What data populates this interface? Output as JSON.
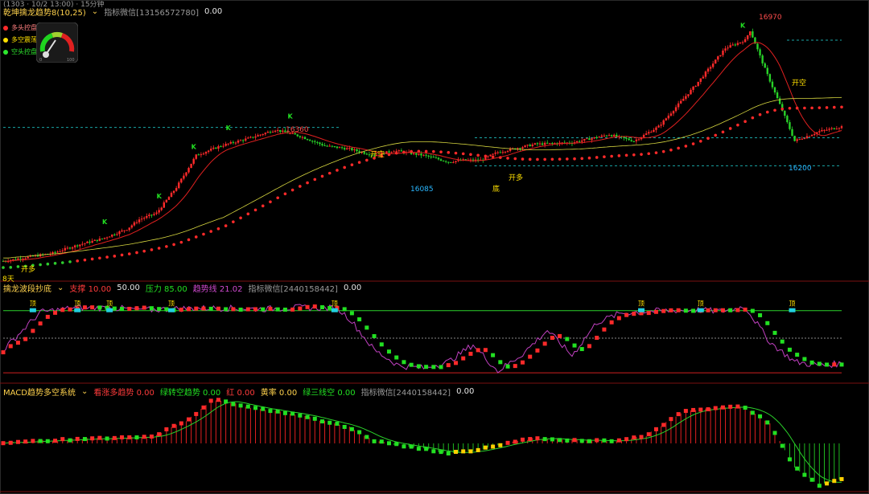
{
  "top_strip": "(1303 · 10/2 13:00) · 15分钟",
  "main": {
    "title": "乾坤擒龙趋势8(10,25)",
    "chevron": "⌄",
    "indicator_name": "指标微信[13156572780]",
    "indicator_value": "0.00",
    "legend": [
      {
        "label": "多头控盘",
        "color": "#ff2b2b"
      },
      {
        "label": "多空震荡",
        "color": "#ffe000"
      },
      {
        "label": "空头控盘",
        "color": "#2ee62e"
      }
    ],
    "gauge_labels": {
      "low": "0",
      "high": "100"
    },
    "annotations": [
      {
        "text": "16970",
        "color": "#ff4d4d"
      },
      {
        "text": "16360",
        "color": "#ff4d4d"
      },
      {
        "text": "16085",
        "color": "#2ab7ff"
      },
      {
        "text": "16200",
        "color": "#2ab7ff"
      },
      {
        "text": "开多",
        "color": "#ffe000"
      },
      {
        "text": "开空",
        "color": "#ffe000"
      },
      {
        "text": "开多",
        "color": "#ffe000"
      },
      {
        "text": "开空",
        "color": "#ffe000"
      },
      {
        "text": "底",
        "color": "#ffe000"
      },
      {
        "text": "8天",
        "color": "#ffe000"
      }
    ]
  },
  "sub1": {
    "title": "擒龙波段抄底",
    "items": [
      {
        "label": "支撑",
        "value": "10.00",
        "color": "#ff3b3b"
      },
      {
        "label": "",
        "value": "50.00",
        "color": "#e6e6e6"
      },
      {
        "label": "压力",
        "value": "85.00",
        "color": "#22e022"
      },
      {
        "label": "趋势线",
        "value": "21.02",
        "color": "#d04ad0"
      }
    ],
    "indicator_name": "指标微信[2440158442]",
    "indicator_value": "0.00",
    "marker_char": "顶"
  },
  "sub2": {
    "title": "MACD趋势多空系统",
    "items": [
      {
        "label": "看涨多趋势",
        "value": "0.00",
        "color": "#ff3b3b"
      },
      {
        "label": "绿转空趋势",
        "value": "0.00",
        "color": "#22e022"
      },
      {
        "label": "红",
        "value": "0.00",
        "color": "#ff3b3b"
      },
      {
        "label": "黄率",
        "value": "0.00",
        "color": "#ffd24d"
      },
      {
        "label": "绿三线空",
        "value": "0.00",
        "color": "#22e022"
      }
    ],
    "indicator_name": "指标微信[2440158442]",
    "indicator_value": "0.00"
  },
  "chart_data": [
    {
      "type": "candlestick",
      "title": "乾坤擒龙趋势8(10,25)",
      "ylim": [
        15420,
        17050
      ],
      "y_labels": {
        "high_peak": 16970,
        "mid_peak": 16360,
        "trough": 16085,
        "recent_low": 16200
      },
      "x_count": 160,
      "series": [
        {
          "name": "close",
          "keypoints": [
            [
              0,
              15520
            ],
            [
              10,
              15545
            ],
            [
              20,
              15570
            ],
            [
              30,
              15620
            ],
            [
              40,
              15660
            ],
            [
              50,
              15720
            ],
            [
              55,
              15780
            ],
            [
              62,
              15820
            ],
            [
              70,
              15980
            ],
            [
              78,
              16180
            ],
            [
              88,
              16240
            ],
            [
              100,
              16290
            ],
            [
              110,
              16340
            ],
            [
              120,
              16300
            ],
            [
              130,
              16240
            ],
            [
              140,
              16220
            ],
            [
              150,
              16180
            ],
            [
              158,
              16210
            ],
            [
              170,
              16180
            ],
            [
              180,
              16140
            ],
            [
              186,
              16150
            ],
            [
              193,
              16150
            ],
            [
              200,
              16200
            ],
            [
              215,
              16250
            ],
            [
              230,
              16260
            ],
            [
              245,
              16310
            ],
            [
              255,
              16270
            ],
            [
              265,
              16360
            ],
            [
              280,
              16620
            ],
            [
              292,
              16850
            ],
            [
              300,
              16900
            ],
            [
              302,
              16960
            ],
            [
              308,
              16720
            ],
            [
              315,
              16460
            ],
            [
              320,
              16270
            ],
            [
              330,
              16330
            ],
            [
              339,
              16360
            ]
          ]
        }
      ]
    },
    {
      "type": "line",
      "title": "擒龙波段抄底",
      "ylim": [
        0,
        100
      ],
      "hlines": [
        10,
        50,
        85
      ],
      "series": [
        {
          "name": "趋势线",
          "keypoints": [
            [
              0,
              35
            ],
            [
              15,
              83
            ],
            [
              30,
              89
            ],
            [
              45,
              88
            ],
            [
              60,
              86
            ],
            [
              75,
              88
            ],
            [
              90,
              88
            ],
            [
              105,
              87
            ],
            [
              120,
              89
            ],
            [
              135,
              88
            ],
            [
              140,
              75
            ],
            [
              150,
              35
            ],
            [
              160,
              15
            ],
            [
              170,
              12
            ],
            [
              180,
              20
            ],
            [
              190,
              42
            ],
            [
              200,
              8
            ],
            [
              210,
              30
            ],
            [
              220,
              60
            ],
            [
              230,
              28
            ],
            [
              240,
              70
            ],
            [
              250,
              82
            ],
            [
              260,
              84
            ],
            [
              270,
              85
            ],
            [
              280,
              86
            ],
            [
              290,
              84
            ],
            [
              300,
              90
            ],
            [
              310,
              45
            ],
            [
              320,
              20
            ],
            [
              330,
              15
            ],
            [
              339,
              18
            ]
          ]
        }
      ]
    },
    {
      "type": "bar",
      "title": "MACD趋势多空系统",
      "ylim": [
        -60,
        60
      ],
      "series": [
        {
          "name": "MACD",
          "keypoints": [
            [
              0,
              1
            ],
            [
              20,
              4
            ],
            [
              40,
              6
            ],
            [
              60,
              8
            ],
            [
              75,
              30
            ],
            [
              85,
              55
            ],
            [
              100,
              45
            ],
            [
              120,
              35
            ],
            [
              140,
              20
            ],
            [
              150,
              3
            ],
            [
              160,
              -2
            ],
            [
              180,
              -12
            ],
            [
              190,
              -10
            ],
            [
              200,
              -2
            ],
            [
              215,
              7
            ],
            [
              230,
              4
            ],
            [
              250,
              3
            ],
            [
              260,
              10
            ],
            [
              275,
              40
            ],
            [
              290,
              45
            ],
            [
              300,
              45
            ],
            [
              310,
              25
            ],
            [
              320,
              -30
            ],
            [
              330,
              -52
            ],
            [
              339,
              -45
            ]
          ]
        }
      ]
    }
  ]
}
